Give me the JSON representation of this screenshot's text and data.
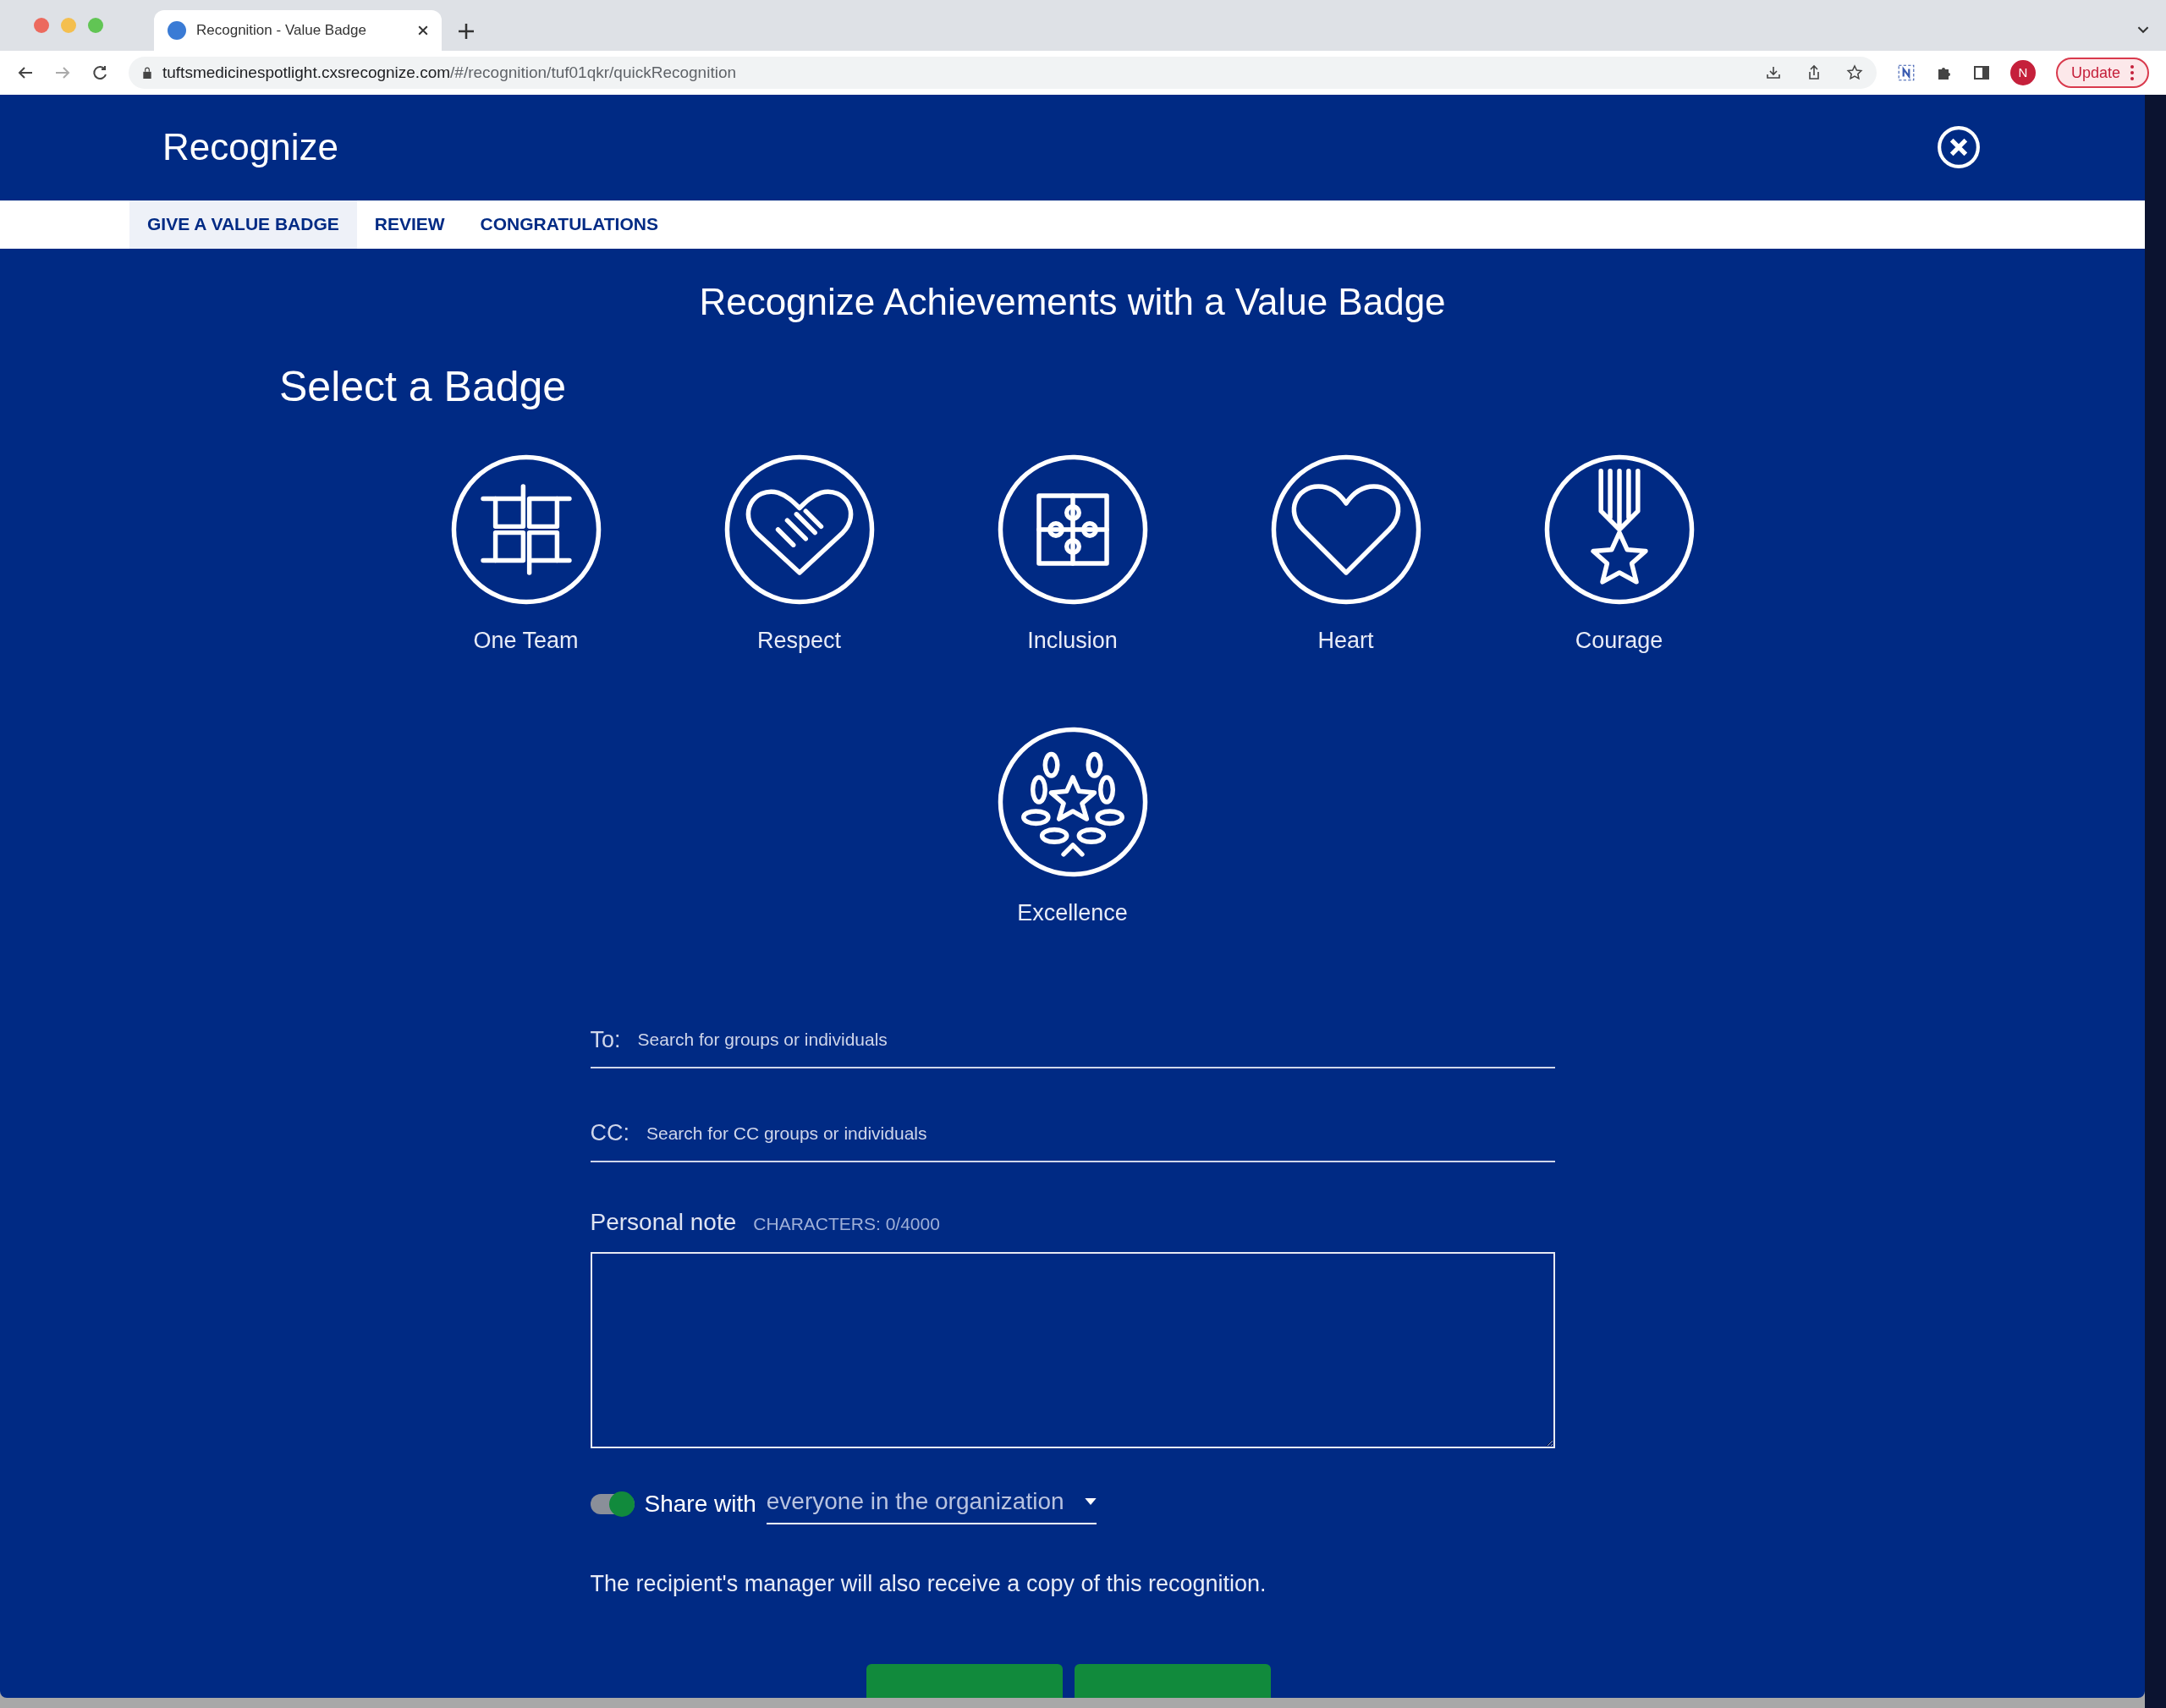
{
  "browser": {
    "tab_title": "Recognition - Value Badge",
    "url_host": "tuftsmedicinespotlight.cxsrecognize.com",
    "url_path": "/#/recognition/tuf01qkr/quickRecognition",
    "profile_initial": "N",
    "update_label": "Update"
  },
  "header": {
    "title": "Recognize"
  },
  "tabs": [
    {
      "label": "GIVE A VALUE BADGE",
      "selected": true
    },
    {
      "label": "REVIEW",
      "selected": false
    },
    {
      "label": "CONGRATULATIONS",
      "selected": false
    }
  ],
  "heading": "Recognize Achievements with a Value Badge",
  "badge_section_title": "Select a Badge",
  "badges": [
    {
      "kind": "hands",
      "label": "One Team"
    },
    {
      "kind": "handshake",
      "label": "Respect"
    },
    {
      "kind": "puzzle",
      "label": "Inclusion"
    },
    {
      "kind": "heart",
      "label": "Heart"
    },
    {
      "kind": "medal",
      "label": "Courage"
    },
    {
      "kind": "laurel",
      "label": "Excellence"
    }
  ],
  "to_field": {
    "label": "To:",
    "placeholder": "Search for groups or individuals"
  },
  "cc_field": {
    "label": "CC:",
    "placeholder": "Search for CC groups or individuals"
  },
  "note": {
    "label": "Personal note",
    "counter": "CHARACTERS: 0/4000"
  },
  "share": {
    "on": true,
    "label": "Share with",
    "value": "everyone in the organization"
  },
  "manager_notice": "The recipient's manager will also receive a copy of this recognition."
}
